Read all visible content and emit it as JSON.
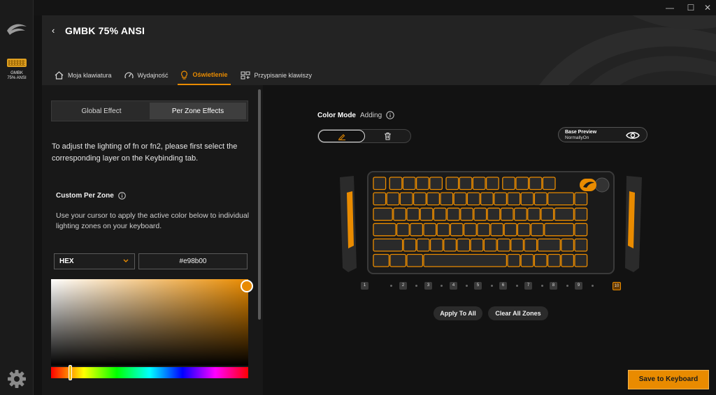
{
  "device": {
    "rail_label_line1": "GMBK",
    "rail_label_line2": "75% ANSI"
  },
  "header": {
    "back_glyph": "‹",
    "title": "GMBK 75% ANSI",
    "tabs": [
      {
        "label": "Moja klawiatura",
        "icon": "home-icon"
      },
      {
        "label": "Wydajność",
        "icon": "speedometer-icon"
      },
      {
        "label": "Oświetlenie",
        "icon": "lightbulb-icon",
        "active": true
      },
      {
        "label": "Przypisanie klawiszy",
        "icon": "keymap-icon"
      }
    ]
  },
  "window": {
    "minimize": "—",
    "maximize": "☐",
    "close": "✕"
  },
  "left_panel": {
    "segments": [
      "Global Effect",
      "Per Zone Effects"
    ],
    "active_segment": "Per Zone Effects",
    "info": "To adjust the lighting of fn or fn2, please first select the corresponding layer on the Keybinding tab.",
    "custom_title": "Custom Per Zone",
    "custom_desc": "Use your cursor to apply the active color below to individual lighting zones on your keyboard.",
    "format_select": "HEX",
    "hex_value": "#e98b00",
    "active_color": "#e98b00",
    "hue_position": 0.09
  },
  "right_panel": {
    "color_mode_label": "Color Mode",
    "color_mode_value": "Adding",
    "base_preview_title": "Base Preview",
    "base_preview_value": "NormallyOn",
    "zones": [
      "1",
      "2",
      "3",
      "4",
      "5",
      "6",
      "7",
      "8",
      "9",
      "10"
    ],
    "active_zone": "10",
    "apply_all": "Apply To All",
    "clear_zones": "Clear All Zones",
    "save": "Save to Keyboard"
  }
}
